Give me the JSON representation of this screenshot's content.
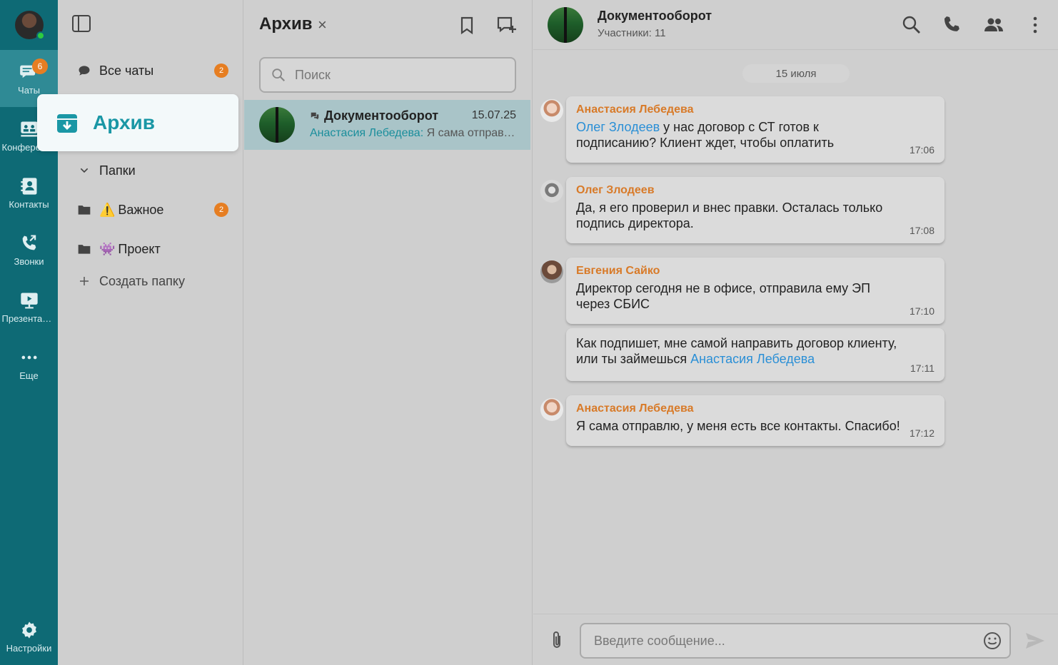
{
  "rail": {
    "chats_label": "Чаты",
    "chats_badge": "6",
    "conf_label": "Конференции",
    "contacts_label": "Контакты",
    "calls_label": "Звонки",
    "present_label": "Презентации",
    "more_label": "Еще",
    "settings_label": "Настройки"
  },
  "folders": {
    "all_chats": "Все чаты",
    "all_chats_badge": "2",
    "archive": "Архив",
    "folders_header": "Папки",
    "important_emoji": "⚠️",
    "important": "Важное",
    "important_badge": "2",
    "project_emoji": "👾",
    "project": "Проект",
    "create_folder": "Создать папку"
  },
  "chatlist": {
    "title": "Архив",
    "close": "×",
    "search_placeholder": "Поиск",
    "items": [
      {
        "name": "Документооборот",
        "date": "15.07.25",
        "preview_author": "Анастасия Лебедева:",
        "preview_text": " Я сама отправлю, у меня есть все контакты. Спасибо!"
      }
    ]
  },
  "conversation": {
    "title": "Документооборот",
    "subtitle": "Участники: 11",
    "date_divider": "15 июля",
    "messages": [
      {
        "author": "Анастасия Лебедева",
        "mention": "Олег Злодеев",
        "text": " у нас договор с СТ готов к подписанию? Клиент ждет, чтобы оплатить",
        "time": "17:06"
      },
      {
        "author": "Олег Злодеев",
        "text": "Да, я его проверил и внес правки. Осталась только подпись директора.",
        "time": "17:08"
      },
      {
        "author": "Евгения Сайко",
        "text": "Директор сегодня не в офисе, отправила ему ЭП через СБИС",
        "time": "17:10"
      },
      {
        "text": "Как подпишет, мне самой направить договор клиенту, или ты займешься ",
        "mention": "Анастасия Лебедева",
        "time": "17:11"
      },
      {
        "author": "Анастасия Лебедева",
        "text": "Я сама отправлю, у меня есть все контакты. Спасибо!",
        "time": "17:12"
      }
    ],
    "composer_placeholder": "Введите сообщение..."
  },
  "colors": {
    "rail": "#0e6a75",
    "accent": "#1a97a5",
    "badge": "#e67e22",
    "author": "#d87a28",
    "mention": "#2a8fd6"
  }
}
